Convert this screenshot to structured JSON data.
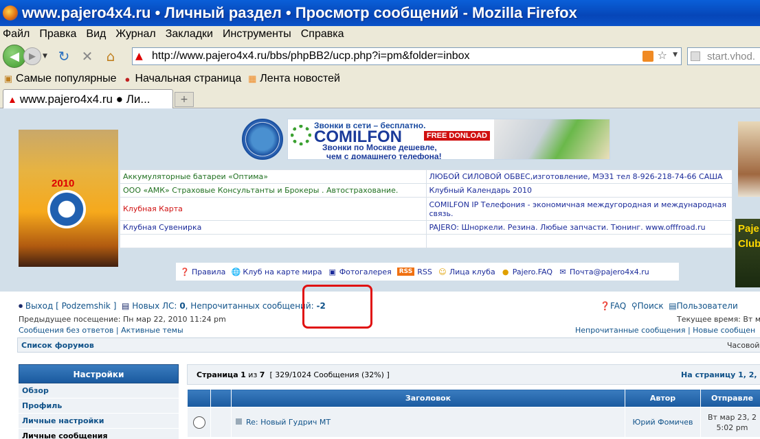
{
  "window": {
    "title": "www.pajero4x4.ru • Личный раздел • Просмотр сообщений - Mozilla Firefox"
  },
  "menu": [
    "Файл",
    "Правка",
    "Вид",
    "Журнал",
    "Закладки",
    "Инструменты",
    "Справка"
  ],
  "nav": {
    "url": "http://www.pajero4x4.ru/bbs/phpBB2/ucp.php?i=pm&folder=inbox",
    "search_text": "start.vhod."
  },
  "bookmarks": [
    "Самые популярные",
    "Начальная страница",
    "Лента новостей"
  ],
  "tab": {
    "title": "www.pajero4x4.ru ● Ли..."
  },
  "header": {
    "poster_year": "2010",
    "right_poster_text": "Paje Club",
    "banner": {
      "top_line": "Звонки в сети – бесплатно.",
      "brand": "COMILFON",
      "badge": "FREE DONLOAD",
      "line2": "Звонки по Москве дешевле,",
      "line3": "чем с домашнего телефона!"
    }
  },
  "ads": [
    {
      "left": "Аккумуляторные батареи «Оптима»",
      "right": "ЛЮБОЙ СИЛОВОЙ ОБВЕС,изготовление, МЭЗ1 тел 8-926-218-74-66 САША"
    },
    {
      "left": "ООО «АМК» Страховые Консультанты и Брокеры . Автострахование.",
      "right": "Клубный Календарь 2010"
    },
    {
      "left": "Клубная Карта",
      "right": "COMILFON IP Телефония - экономичная междугородная и международная связь."
    },
    {
      "left": "Клубная Сувенирка",
      "right": "PAJERO: Шноркели. Резина. Любые запчасти. Тюнинг. www.offfroad.ru"
    },
    {
      "left": "",
      "right": ""
    }
  ],
  "iconbar": {
    "rules": "Правила",
    "map": "Клуб на карте мира",
    "gallery": "Фотогалерея",
    "rss_badge": "RSS",
    "rss": "RSS",
    "faces": "Лица клуба",
    "faq": "Pajero.FAQ",
    "mail": "Почта@pajero4x4.ru"
  },
  "usernav": {
    "logout": "Выход [ Podzemshik ]",
    "new_pm_label": "Новых ЛС:",
    "new_pm_count": "0",
    "unread_label": ", Непрочитанных сообщений:",
    "unread_count": "-2",
    "prev_visit": "Предыдущее посещение: Пн мар 22, 2010 11:24 pm",
    "unanswered": "Сообщения без ответов",
    "active": "Активные темы",
    "faq": "FAQ",
    "search": "Поиск",
    "users": "Пользователи",
    "current_time": "Текущее время: Вт м",
    "unread_posts": "Непрочитанные сообщения",
    "new_posts": "Новые сообщен"
  },
  "breadcrumb": {
    "forum_list": "Список форумов",
    "timezone": "Часовой"
  },
  "sidebar": {
    "title": "Настройки",
    "items": [
      "Обзор",
      "Профиль",
      "Личные настройки",
      "Личные сообщения"
    ]
  },
  "pagination": {
    "page_label": "Страница",
    "page": "1",
    "of_label": "из",
    "total_pages": "7",
    "count_text": "[ 329/1024 Сообщения (32%) ]",
    "goto": "На страницу 1, 2,"
  },
  "messages": {
    "headers": {
      "subject": "Заголовок",
      "author": "Автор",
      "sent": "Отправле"
    },
    "rows": [
      {
        "subject": "Re: Новый Гудрич МТ",
        "author": "Юрий Фомичев",
        "date": "Вт мар 23, 2",
        "time": "5:02 pm"
      }
    ]
  }
}
